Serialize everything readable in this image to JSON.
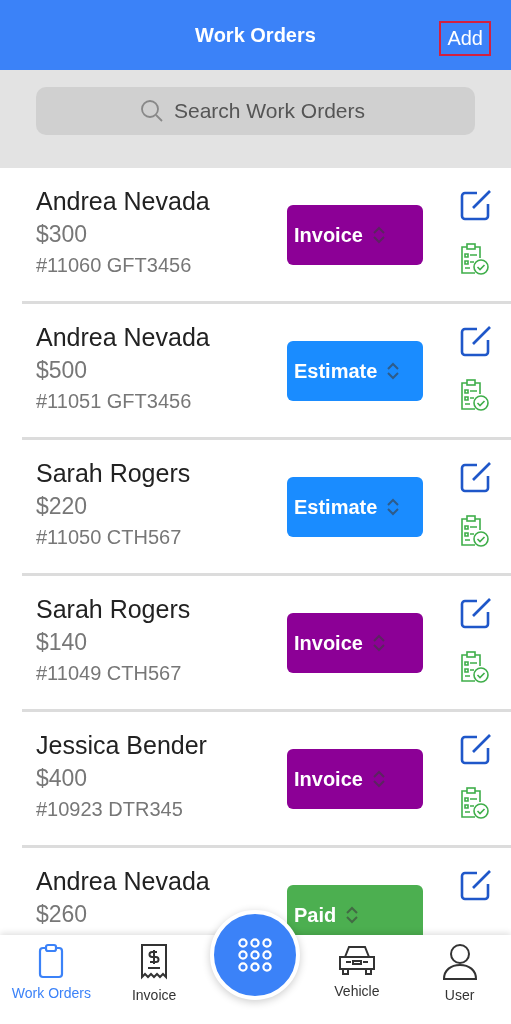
{
  "header": {
    "title": "Work Orders",
    "action": "Add"
  },
  "search": {
    "placeholder": "Search Work Orders"
  },
  "orders": [
    {
      "customer": "Andrea Nevada",
      "amount": "$300",
      "reference": "#11060 GFT3456",
      "status": {
        "label": "Invoice",
        "kind": "invoice"
      }
    },
    {
      "customer": "Andrea Nevada",
      "amount": "$500",
      "reference": "#11051 GFT3456",
      "status": {
        "label": "Estimate",
        "kind": "estimate"
      }
    },
    {
      "customer": "Sarah Rogers",
      "amount": "$220",
      "reference": "#11050 CTH567",
      "status": {
        "label": "Estimate",
        "kind": "estimate"
      }
    },
    {
      "customer": "Sarah Rogers",
      "amount": "$140",
      "reference": "#11049 CTH567",
      "status": {
        "label": "Invoice",
        "kind": "invoice"
      }
    },
    {
      "customer": "Jessica Bender",
      "amount": "$400",
      "reference": "#10923 DTR345",
      "status": {
        "label": "Invoice",
        "kind": "invoice"
      }
    },
    {
      "customer": "Andrea Nevada",
      "amount": "$260",
      "status": {
        "label": "Paid",
        "kind": "paid"
      }
    }
  ],
  "tabs": [
    {
      "label": "Work Orders",
      "kind": "clipboard",
      "selected": true
    },
    {
      "label": "Invoice",
      "kind": "receipt",
      "selected": false
    },
    {
      "label": "Vehicle",
      "kind": "car",
      "selected": false
    },
    {
      "label": "User",
      "kind": "user",
      "selected": false
    }
  ]
}
